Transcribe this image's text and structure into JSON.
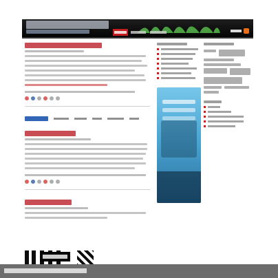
{
  "colors": {
    "header_bg": "#050505",
    "accent_red": "#c31e1e",
    "link_red": "#b5121b",
    "ad_blue": "#4aa6d3",
    "watermark_grey": "#6d6d6d",
    "google_ads_blue": "#3466b8"
  },
  "header": {
    "site_title": "",
    "site_tagline": "",
    "nav": [
      {
        "label": ""
      },
      {
        "label": ""
      },
      {
        "label": ""
      }
    ],
    "rss_label": ""
  },
  "main": {
    "posts": [
      {
        "title": "",
        "meta": "",
        "excerpt": "",
        "tags": ""
      },
      {
        "title": "",
        "meta": "",
        "excerpt": "",
        "tags": ""
      },
      {
        "title": "",
        "meta": "",
        "excerpt": ""
      }
    ],
    "ads_row": {
      "badge": "",
      "links": [
        "",
        "",
        "",
        "",
        ""
      ]
    }
  },
  "sidebar": {
    "recent_posts_title": "",
    "recent_posts": [
      "",
      "",
      "",
      "",
      "",
      "",
      ""
    ],
    "ad_text": "",
    "tags_title": "",
    "tags": [
      "",
      "",
      "",
      "",
      "",
      "",
      "",
      "",
      "",
      ""
    ],
    "meta_title": "",
    "meta_links": [
      "",
      "",
      "",
      "",
      ""
    ]
  },
  "watermark": {
    "text": ""
  },
  "icons": {
    "rss": "rss-icon",
    "bullet": "bullet-icon",
    "post_actions": [
      "digg-icon",
      "delicious-icon",
      "stumble-icon",
      "reddit-icon",
      "email-icon",
      "print-icon"
    ]
  }
}
